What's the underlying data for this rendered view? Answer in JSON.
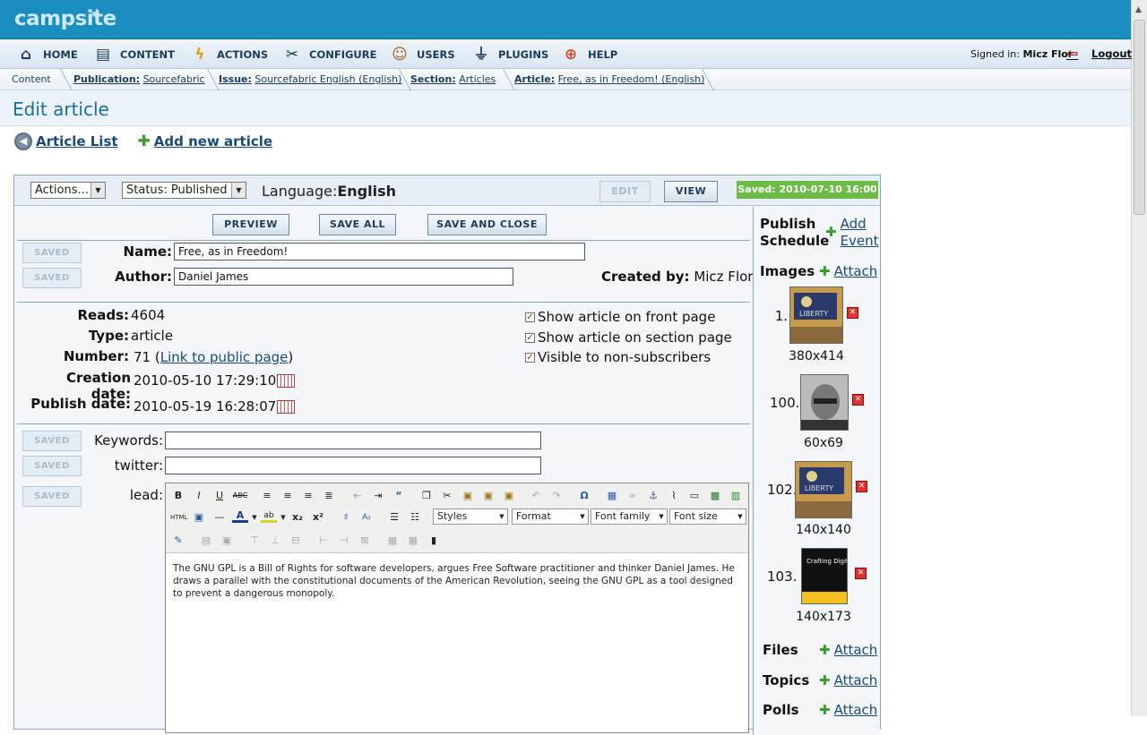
{
  "app": {
    "logo": "campsite"
  },
  "nav": {
    "items": [
      {
        "label": "HOME",
        "icon": "home-icon"
      },
      {
        "label": "CONTENT",
        "icon": "content-icon"
      },
      {
        "label": "ACTIONS",
        "icon": "lightning-icon"
      },
      {
        "label": "CONFIGURE",
        "icon": "tools-icon"
      },
      {
        "label": "USERS",
        "icon": "users-icon"
      },
      {
        "label": "PLUGINS",
        "icon": "plug-icon"
      },
      {
        "label": "HELP",
        "icon": "lifebuoy-icon"
      }
    ],
    "signed_in_label": "Signed in:",
    "signed_in_user": "Micz Flor",
    "logout": "Logout"
  },
  "breadcrumb": {
    "root": "Content",
    "publication_label": "Publication:",
    "publication": "Sourcefabric",
    "issue_label": "Issue:",
    "issue": "Sourcefabric English (English)",
    "section_label": "Section:",
    "section": "Articles",
    "article_label": "Article:",
    "article": "Free, as in Freedom! (English)"
  },
  "page": {
    "title": "Edit article",
    "article_list": "Article List",
    "add_new": "Add new article"
  },
  "toolbar": {
    "actions": "Actions...",
    "status": "Status: Published",
    "language_label": "Language:",
    "language": "English",
    "edit": "EDIT",
    "view": "VIEW",
    "saved_badge": "Saved: 2010-07-10 16:00"
  },
  "buttons": {
    "preview": "PREVIEW",
    "save_all": "SAVE ALL",
    "save_close": "SAVE AND CLOSE",
    "saved": "SAVED"
  },
  "form": {
    "name_label": "Name:",
    "name_value": "Free, as in Freedom!",
    "author_label": "Author:",
    "author_value": "Daniel James",
    "created_by_label": "Created by:",
    "created_by": "Micz Flor",
    "reads_label": "Reads:",
    "reads": "4604",
    "type_label": "Type:",
    "type": "article",
    "number_label": "Number:",
    "number": "71",
    "link_public": "Link to public page",
    "creation_label": "Creation date:",
    "creation_date": "2010-05-10 17:29:10",
    "publish_label": "Publish date:",
    "publish_date": "2010-05-19 16:28:07",
    "check_front": "Show article on front page",
    "check_section": "Show article on section page",
    "check_visible": "Visible to non-subscribers",
    "keywords_label": "Keywords:",
    "keywords_value": "",
    "twitter_label": "twitter:",
    "twitter_value": "",
    "lead_label": "lead:"
  },
  "editor": {
    "styles": "Styles",
    "format": "Format",
    "font_family": "Font family",
    "font_size": "Font size",
    "content": "The GNU GPL is a Bill of Rights for software developers, argues Free Software practitioner and thinker Daniel James. He draws a parallel with the constitutional documents of the American Revolution, seeing the GNU GPL as a tool designed to prevent a dangerous monopoly."
  },
  "sidebar": {
    "publish_schedule": "Publish Schedule",
    "add_event": "Add Event",
    "images": "Images",
    "attach": "Attach",
    "image_list": [
      {
        "num": "1.",
        "size": "380x414"
      },
      {
        "num": "100.",
        "size": "60x69"
      },
      {
        "num": "102.",
        "size": "140x140"
      },
      {
        "num": "103.",
        "size": "140x173"
      }
    ],
    "files": "Files",
    "topics": "Topics",
    "polls": "Polls",
    "book_cover_text": "Crafting Digital Media"
  }
}
